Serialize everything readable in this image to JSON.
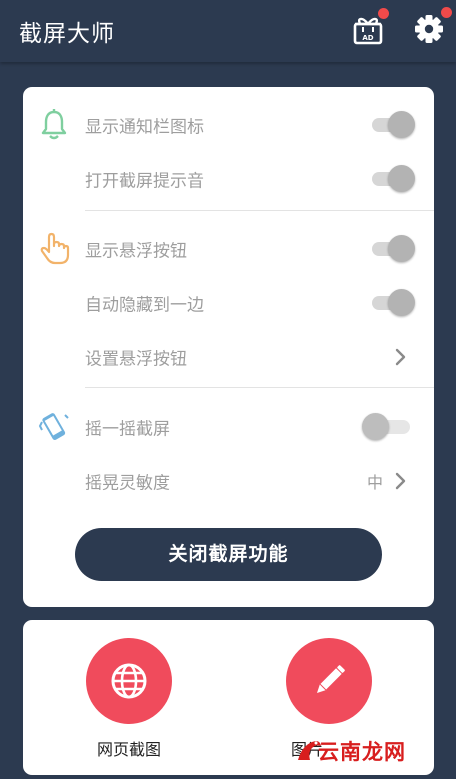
{
  "app": {
    "title": "截屏大师"
  },
  "header": {
    "ad_icon_label": "AD",
    "has_ad_badge": true,
    "has_settings_badge": true
  },
  "settings": {
    "notification_icon": {
      "label": "显示通知栏图标",
      "on": true
    },
    "capture_sound": {
      "label": "打开截屏提示音",
      "on": true
    },
    "show_float_button": {
      "label": "显示悬浮按钮",
      "on": true
    },
    "auto_hide": {
      "label": "自动隐藏到一边",
      "on": true
    },
    "float_settings": {
      "label": "设置悬浮按钮"
    },
    "shake_capture": {
      "label": "摇一摇截屏",
      "on": false
    },
    "shake_sensitivity": {
      "label": "摇晃灵敏度",
      "value": "中"
    }
  },
  "actions": {
    "close_label": "关闭截屏功能"
  },
  "tools": [
    {
      "label": "网页截图",
      "icon": "globe-icon"
    },
    {
      "label": "图片",
      "icon": "pencil-icon"
    }
  ],
  "watermark": {
    "text": "云南龙网"
  },
  "colors": {
    "primary": "#2c3a50",
    "accent_red": "#f04b5c",
    "badge_red": "#f04a4a",
    "bell_green": "#7fcf9f",
    "hand_orange": "#f2b36a",
    "phone_blue": "#6fb1dd"
  }
}
